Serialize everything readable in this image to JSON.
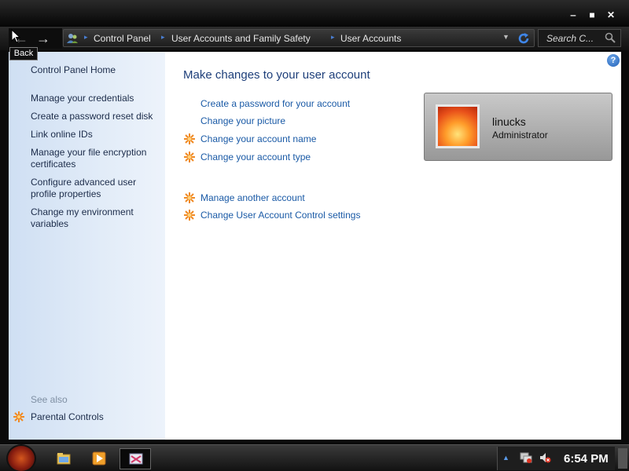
{
  "window": {
    "minimize": "‒",
    "maximize": "■",
    "close": "✕"
  },
  "nav": {
    "back_tooltip": "Back",
    "breadcrumbs": [
      "Control Panel",
      "User Accounts and Family Safety",
      "User Accounts"
    ],
    "search_placeholder": "Search C..."
  },
  "sidebar": {
    "home": "Control Panel Home",
    "links": [
      "Manage your credentials",
      "Create a password reset disk",
      "Link online IDs",
      "Manage your file encryption certificates",
      "Configure advanced user profile properties",
      "Change my environment variables"
    ],
    "see_also_label": "See also",
    "see_also": [
      "Parental Controls"
    ]
  },
  "main": {
    "title": "Make changes to your user account",
    "tasks": [
      {
        "label": "Create a password for your account",
        "shield": false
      },
      {
        "label": "Change your picture",
        "shield": false
      },
      {
        "label": "Change your account name",
        "shield": true
      },
      {
        "label": "Change your account type",
        "shield": true
      }
    ],
    "other_tasks": [
      {
        "label": "Manage another account",
        "shield": true
      },
      {
        "label": "Change User Account Control settings",
        "shield": true
      }
    ],
    "help": "?"
  },
  "account": {
    "name": "linucks",
    "role": "Administrator"
  },
  "taskbar": {
    "clock": "6:54 PM",
    "buttons": [
      "explorer-icon",
      "media-player-icon",
      "control-panel-icon"
    ]
  },
  "colors": {
    "link": "#1a5aa6",
    "title": "#1e3f7a",
    "shield": "#f08a24"
  }
}
